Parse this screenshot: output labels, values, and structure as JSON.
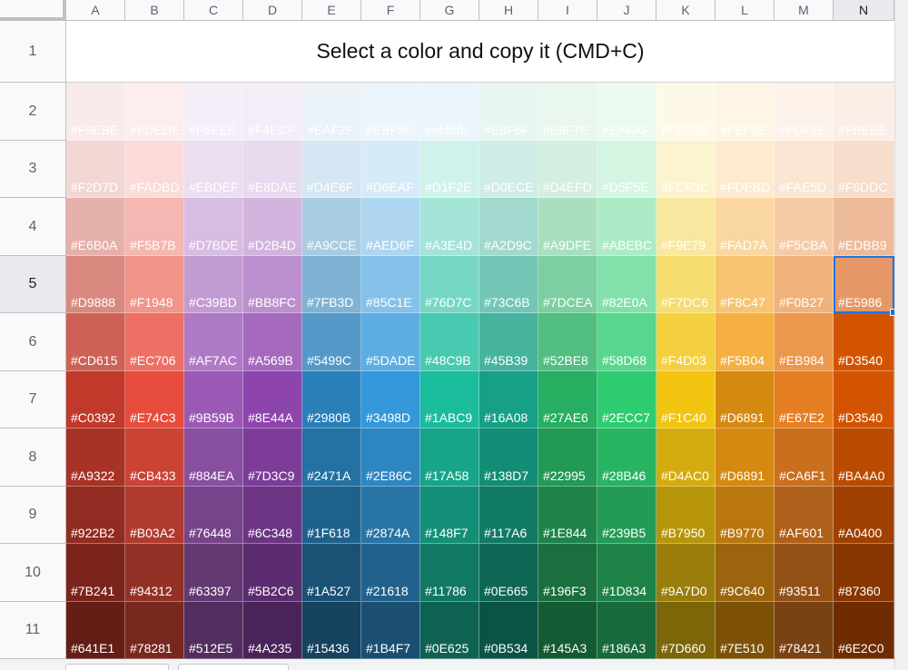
{
  "columns": [
    "A",
    "B",
    "C",
    "D",
    "E",
    "F",
    "G",
    "H",
    "I",
    "J",
    "K",
    "L",
    "M",
    "N"
  ],
  "row_numbers": [
    "1",
    "2",
    "3",
    "4",
    "5",
    "6",
    "7",
    "8",
    "9",
    "10",
    "11"
  ],
  "title": "Select a color and copy it (CMD+C)",
  "selected_cell": {
    "col": "N",
    "row": "5"
  },
  "colors": [
    [
      {
        "hex": "#F9EBEA",
        "label": "#F9EBE"
      },
      {
        "hex": "#FDEDEC",
        "label": "#FDEDE"
      },
      {
        "hex": "#F5EEF8",
        "label": "#F5EEF"
      },
      {
        "hex": "#F4ECF7",
        "label": "#F4ECF"
      },
      {
        "hex": "#EAF2F8",
        "label": "#EAF2F"
      },
      {
        "hex": "#EBF5FB",
        "label": "#EBF5F"
      },
      {
        "hex": "#EBF5FB",
        "label": "#ebf5fb"
      },
      {
        "hex": "#E8F6F3",
        "label": "#E8F6F"
      },
      {
        "hex": "#E9F7EF",
        "label": "#E9F7E"
      },
      {
        "hex": "#EAFAF1",
        "label": "#EAFAF"
      },
      {
        "hex": "#FEF9E7",
        "label": "#FEF9E"
      },
      {
        "hex": "#FEF5E7",
        "label": "#FEF5E"
      },
      {
        "hex": "#FDF2E9",
        "label": "#FDF2E"
      },
      {
        "hex": "#FBEEE6",
        "label": "#FBEEE"
      }
    ],
    [
      {
        "hex": "#F2D7D5",
        "label": "#F2D7D"
      },
      {
        "hex": "#FADBD8",
        "label": "#FADBD"
      },
      {
        "hex": "#EBDEF0",
        "label": "#EBDEF"
      },
      {
        "hex": "#E8DAEF",
        "label": "#E8DAE"
      },
      {
        "hex": "#D4E6F1",
        "label": "#D4E6F"
      },
      {
        "hex": "#D6EAF8",
        "label": "#D6EAF"
      },
      {
        "hex": "#D1F2EB",
        "label": "#D1F2E"
      },
      {
        "hex": "#D0ECE7",
        "label": "#D0ECE"
      },
      {
        "hex": "#D4EFDF",
        "label": "#D4EFD"
      },
      {
        "hex": "#D5F5E3",
        "label": "#D5F5E"
      },
      {
        "hex": "#FCF3CF",
        "label": "#FCF3C"
      },
      {
        "hex": "#FDEBD0",
        "label": "#FDEBD"
      },
      {
        "hex": "#FAE5D3",
        "label": "#FAE5D"
      },
      {
        "hex": "#F6DDCC",
        "label": "#F6DDC"
      }
    ],
    [
      {
        "hex": "#E6B0AA",
        "label": "#E6B0A"
      },
      {
        "hex": "#F5B7B1",
        "label": "#F5B7B"
      },
      {
        "hex": "#D7BDE2",
        "label": "#D7BDE"
      },
      {
        "hex": "#D2B4DE",
        "label": "#D2B4D"
      },
      {
        "hex": "#A9CCE3",
        "label": "#A9CCE"
      },
      {
        "hex": "#AED6F1",
        "label": "#AED6F"
      },
      {
        "hex": "#A3E4D7",
        "label": "#A3E4D"
      },
      {
        "hex": "#A2D9CE",
        "label": "#A2D9C"
      },
      {
        "hex": "#A9DFBF",
        "label": "#A9DFE"
      },
      {
        "hex": "#ABEBC6",
        "label": "#ABEBC"
      },
      {
        "hex": "#F9E79F",
        "label": "#F9E79"
      },
      {
        "hex": "#FAD7A0",
        "label": "#FAD7A"
      },
      {
        "hex": "#F5CBA7",
        "label": "#F5CBA"
      },
      {
        "hex": "#EDBB99",
        "label": "#EDBB9"
      }
    ],
    [
      {
        "hex": "#D98880",
        "label": "#D9888"
      },
      {
        "hex": "#F1948A",
        "label": "#F1948"
      },
      {
        "hex": "#C39BD3",
        "label": "#C39BD"
      },
      {
        "hex": "#BB8FCE",
        "label": "#BB8FC"
      },
      {
        "hex": "#7FB3D5",
        "label": "#7FB3D"
      },
      {
        "hex": "#85C1E9",
        "label": "#85C1E"
      },
      {
        "hex": "#76D7C4",
        "label": "#76D7C"
      },
      {
        "hex": "#73C6B6",
        "label": "#73C6B"
      },
      {
        "hex": "#7DCEA0",
        "label": "#7DCEA"
      },
      {
        "hex": "#82E0AA",
        "label": "#82E0A"
      },
      {
        "hex": "#F7DC6F",
        "label": "#F7DC6"
      },
      {
        "hex": "#F8C471",
        "label": "#F8C47"
      },
      {
        "hex": "#F0B27A",
        "label": "#F0B27"
      },
      {
        "hex": "#E59866",
        "label": "#E5986"
      }
    ],
    [
      {
        "hex": "#CD6155",
        "label": "#CD615"
      },
      {
        "hex": "#EC7063",
        "label": "#EC706"
      },
      {
        "hex": "#AF7AC5",
        "label": "#AF7AC"
      },
      {
        "hex": "#A569BD",
        "label": "#A569B"
      },
      {
        "hex": "#5499C7",
        "label": "#5499C"
      },
      {
        "hex": "#5DADE2",
        "label": "#5DADE"
      },
      {
        "hex": "#48C9B0",
        "label": "#48C9B"
      },
      {
        "hex": "#45B39D",
        "label": "#45B39"
      },
      {
        "hex": "#52BE80",
        "label": "#52BE8"
      },
      {
        "hex": "#58D68D",
        "label": "#58D68"
      },
      {
        "hex": "#F4D03F",
        "label": "#F4D03"
      },
      {
        "hex": "#F5B041",
        "label": "#F5B04"
      },
      {
        "hex": "#EB984E",
        "label": "#EB984"
      },
      {
        "hex": "#D35400",
        "label": "#D3540"
      }
    ],
    [
      {
        "hex": "#C0392B",
        "label": "#C0392"
      },
      {
        "hex": "#E74C3C",
        "label": "#E74C3"
      },
      {
        "hex": "#9B59B6",
        "label": "#9B59B"
      },
      {
        "hex": "#8E44AD",
        "label": "#8E44A"
      },
      {
        "hex": "#2980B9",
        "label": "#2980B"
      },
      {
        "hex": "#3498DB",
        "label": "#3498D"
      },
      {
        "hex": "#1ABC9C",
        "label": "#1ABC9"
      },
      {
        "hex": "#16A085",
        "label": "#16A08"
      },
      {
        "hex": "#27AE60",
        "label": "#27AE6"
      },
      {
        "hex": "#2ECC71",
        "label": "#2ECC7"
      },
      {
        "hex": "#F1C40F",
        "label": "#F1C40"
      },
      {
        "hex": "#D68910",
        "label": "#D6891"
      },
      {
        "hex": "#E67E22",
        "label": "#E67E2"
      },
      {
        "hex": "#D35400",
        "label": "#D3540"
      }
    ],
    [
      {
        "hex": "#A93226",
        "label": "#A9322"
      },
      {
        "hex": "#CB4335",
        "label": "#CB433"
      },
      {
        "hex": "#884EA0",
        "label": "#884EA"
      },
      {
        "hex": "#7D3C98",
        "label": "#7D3C9"
      },
      {
        "hex": "#2471A3",
        "label": "#2471A"
      },
      {
        "hex": "#2E86C1",
        "label": "#2E86C"
      },
      {
        "hex": "#17A589",
        "label": "#17A58"
      },
      {
        "hex": "#138D75",
        "label": "#138D7"
      },
      {
        "hex": "#229954",
        "label": "#22995"
      },
      {
        "hex": "#28B463",
        "label": "#28B46"
      },
      {
        "hex": "#D4AC0D",
        "label": "#D4AC0"
      },
      {
        "hex": "#D68910",
        "label": "#D6891"
      },
      {
        "hex": "#CA6F1E",
        "label": "#CA6F1"
      },
      {
        "hex": "#BA4A00",
        "label": "#BA4A0"
      }
    ],
    [
      {
        "hex": "#922B21",
        "label": "#922B2"
      },
      {
        "hex": "#B03A2E",
        "label": "#B03A2"
      },
      {
        "hex": "#76448A",
        "label": "#76448"
      },
      {
        "hex": "#6C3483",
        "label": "#6C348"
      },
      {
        "hex": "#1F618D",
        "label": "#1F618"
      },
      {
        "hex": "#2874A6",
        "label": "#2874A"
      },
      {
        "hex": "#148F77",
        "label": "#148F7"
      },
      {
        "hex": "#117A65",
        "label": "#117A6"
      },
      {
        "hex": "#1E8449",
        "label": "#1E844"
      },
      {
        "hex": "#239B56",
        "label": "#239B5"
      },
      {
        "hex": "#B7950B",
        "label": "#B7950"
      },
      {
        "hex": "#B9770E",
        "label": "#B9770"
      },
      {
        "hex": "#AF601A",
        "label": "#AF601"
      },
      {
        "hex": "#A04000",
        "label": "#A0400"
      }
    ],
    [
      {
        "hex": "#7B241C",
        "label": "#7B241"
      },
      {
        "hex": "#943126",
        "label": "#94312"
      },
      {
        "hex": "#633974",
        "label": "#63397"
      },
      {
        "hex": "#5B2C6F",
        "label": "#5B2C6"
      },
      {
        "hex": "#1A5276",
        "label": "#1A527"
      },
      {
        "hex": "#21618C",
        "label": "#21618"
      },
      {
        "hex": "#117864",
        "label": "#11786"
      },
      {
        "hex": "#0E6655",
        "label": "#0E665"
      },
      {
        "hex": "#196F3D",
        "label": "#196F3"
      },
      {
        "hex": "#1D8348",
        "label": "#1D834"
      },
      {
        "hex": "#9A7D0A",
        "label": "#9A7D0"
      },
      {
        "hex": "#9C640C",
        "label": "#9C640"
      },
      {
        "hex": "#935116",
        "label": "#93511"
      },
      {
        "hex": "#873600",
        "label": "#87360"
      }
    ],
    [
      {
        "hex": "#641E16",
        "label": "#641E1"
      },
      {
        "hex": "#78281F",
        "label": "#78281"
      },
      {
        "hex": "#512E5F",
        "label": "#512E5"
      },
      {
        "hex": "#4A235A",
        "label": "#4A235"
      },
      {
        "hex": "#154360",
        "label": "#15436"
      },
      {
        "hex": "#1B4F72",
        "label": "#1B4F7"
      },
      {
        "hex": "#0E6251",
        "label": "#0E625"
      },
      {
        "hex": "#0B5345",
        "label": "#0B534"
      },
      {
        "hex": "#145A32",
        "label": "#145A3"
      },
      {
        "hex": "#186A3B",
        "label": "#186A3"
      },
      {
        "hex": "#7D6608",
        "label": "#7D660"
      },
      {
        "hex": "#7E5109",
        "label": "#7E510"
      },
      {
        "hex": "#784212",
        "label": "#78421"
      },
      {
        "hex": "#6E2C00",
        "label": "#6E2C0"
      }
    ]
  ]
}
